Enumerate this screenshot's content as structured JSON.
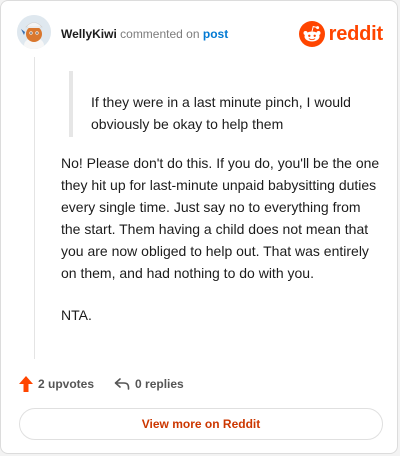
{
  "comment": {
    "author": "WellyKiwi",
    "action_text": "commented on",
    "link_text": "post",
    "quote": "If they were in a last minute pinch, I would obviously be okay to help them",
    "paragraphs": [
      "No! Please don't do this. If you do, you'll be the one they hit up for last-minute unpaid babysitting duties every single time. Just say no to everything from the start. Them having a child does not mean that you are now obliged to help out. That was entirely on them, and had nothing to do with you.",
      "NTA."
    ]
  },
  "brand": {
    "name": "reddit",
    "icon": "reddit-logo-icon",
    "color": "#ff4500"
  },
  "stats": {
    "upvotes_label": "2 upvotes",
    "replies_label": "0 replies",
    "upvote_icon": "upvote-arrow-icon",
    "reply_icon": "reply-arrow-icon",
    "upvote_color": "#ff4500"
  },
  "cta": {
    "label": "View more on Reddit",
    "color": "#cc3700"
  }
}
